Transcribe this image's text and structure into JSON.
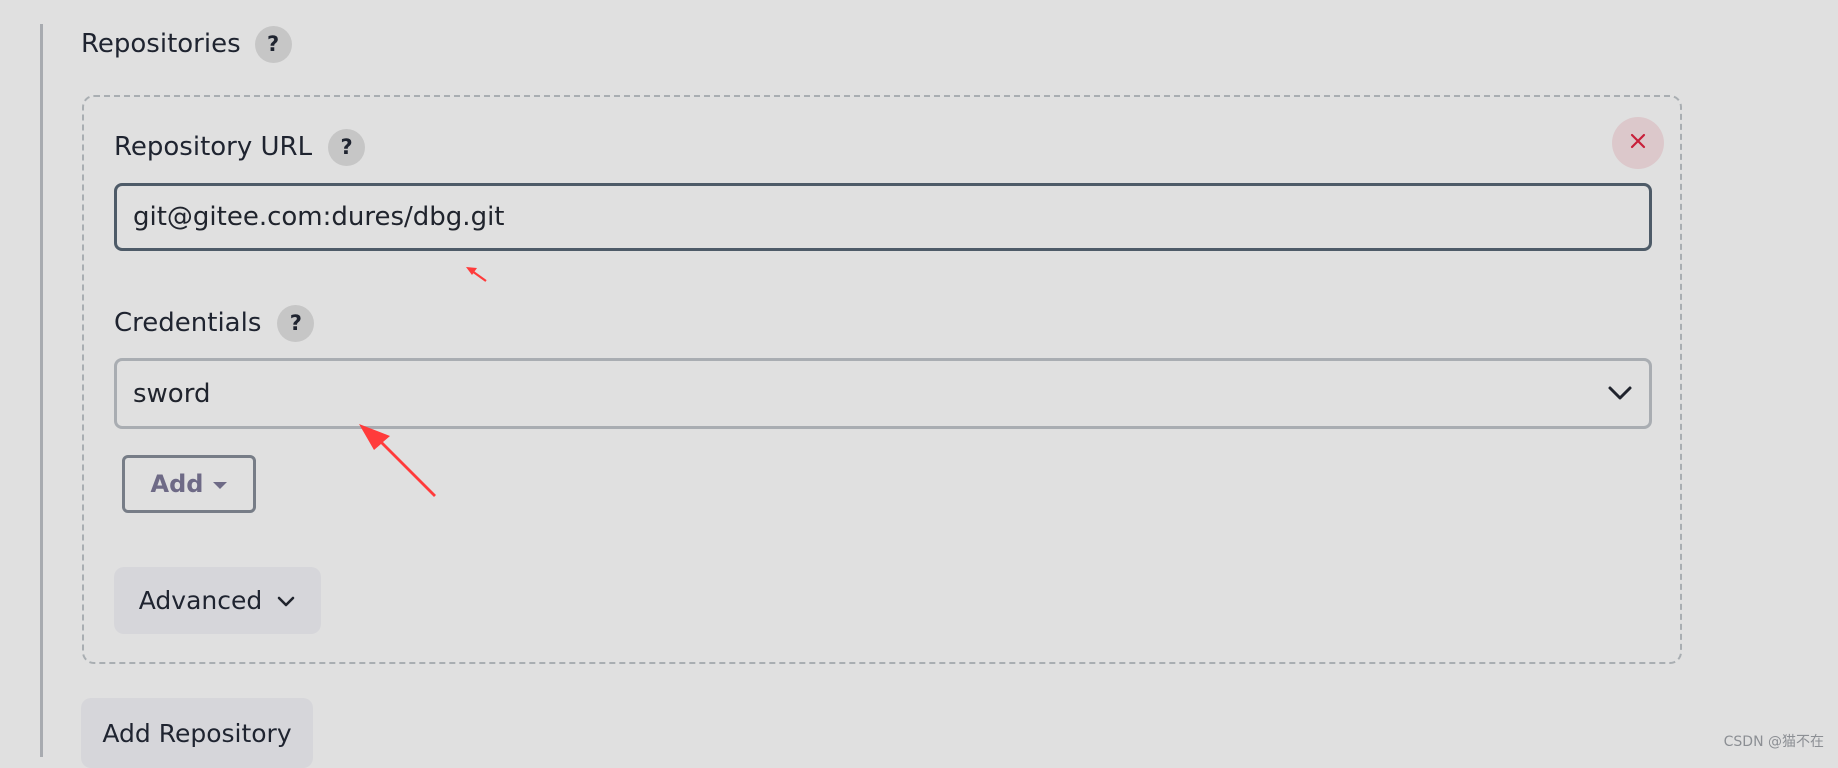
{
  "section": {
    "title": "Repositories",
    "help_label": "?"
  },
  "repository": {
    "url_label": "Repository URL",
    "url_value": "git@gitee.com:dures/dbg.git",
    "help_label": "?"
  },
  "credentials": {
    "label": "Credentials",
    "selected": "sword",
    "help_label": "?"
  },
  "buttons": {
    "add": "Add",
    "advanced": "Advanced",
    "add_repository": "Add Repository",
    "remove_icon": "close-icon"
  },
  "annotations": {
    "arrow_color": "#ff3b3b"
  },
  "watermark": "CSDN @猫不在"
}
